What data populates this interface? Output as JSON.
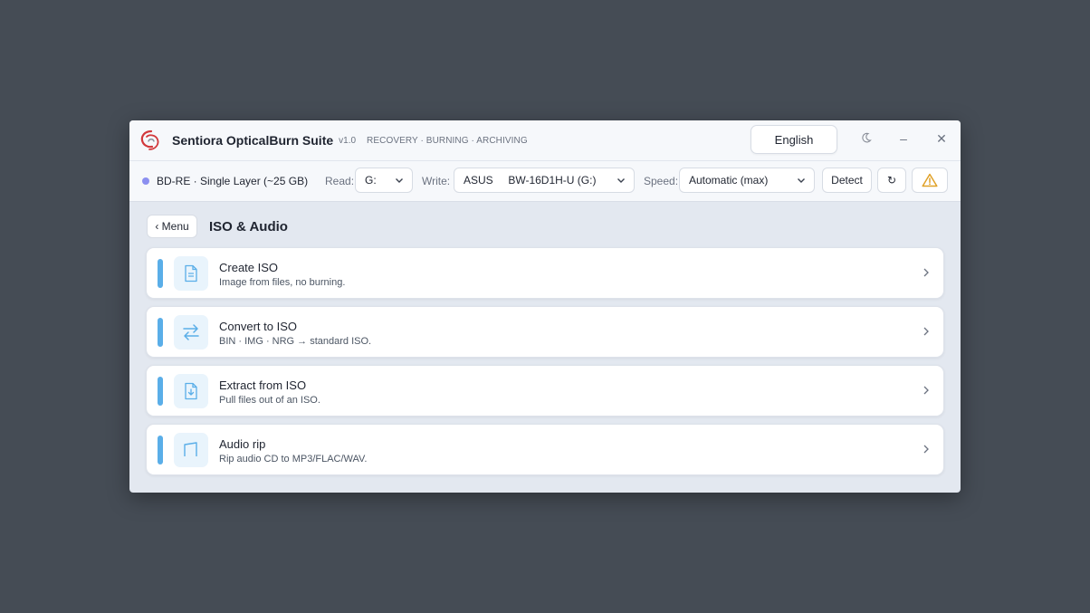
{
  "titlebar": {
    "app_name": "Sentiora OpticalBurn Suite",
    "version": "v1.0",
    "tagline": "RECOVERY · BURNING · ARCHIVING",
    "language": "English",
    "theme_icon": "moon-icon",
    "minimize_symbol": "–",
    "close_symbol": "✕"
  },
  "toolbar": {
    "disc": "BD-RE · Single Layer (~25 GB)",
    "read_label": "Read:",
    "read_value": "G:",
    "write_label": "Write:",
    "write_value": "ASUS     BW-16D1H-U (G:)",
    "speed_label": "Speed:",
    "speed_value": "Automatic (max)",
    "detect_label": "Detect",
    "refresh_symbol": "↻"
  },
  "page": {
    "back_label": "‹ Menu",
    "title": "ISO & Audio"
  },
  "items": [
    {
      "title": "Create ISO",
      "desc": "Image from files, no burning.",
      "icon": "document-icon"
    },
    {
      "title": "Convert to ISO",
      "desc": "BIN · IMG · NRG → standard ISO.",
      "icon": "swap-arrows-icon"
    },
    {
      "title": "Extract from ISO",
      "desc": "Pull files out of an ISO.",
      "icon": "file-download-icon"
    },
    {
      "title": "Audio rip",
      "desc": "Rip audio CD to MP3/FLAC/WAV.",
      "icon": "audio-icon"
    }
  ],
  "colors": {
    "accent": "#5aaee8",
    "warning": "#e0a128",
    "disc_dot": "#8b8ff0",
    "logo": "#d2383b"
  }
}
